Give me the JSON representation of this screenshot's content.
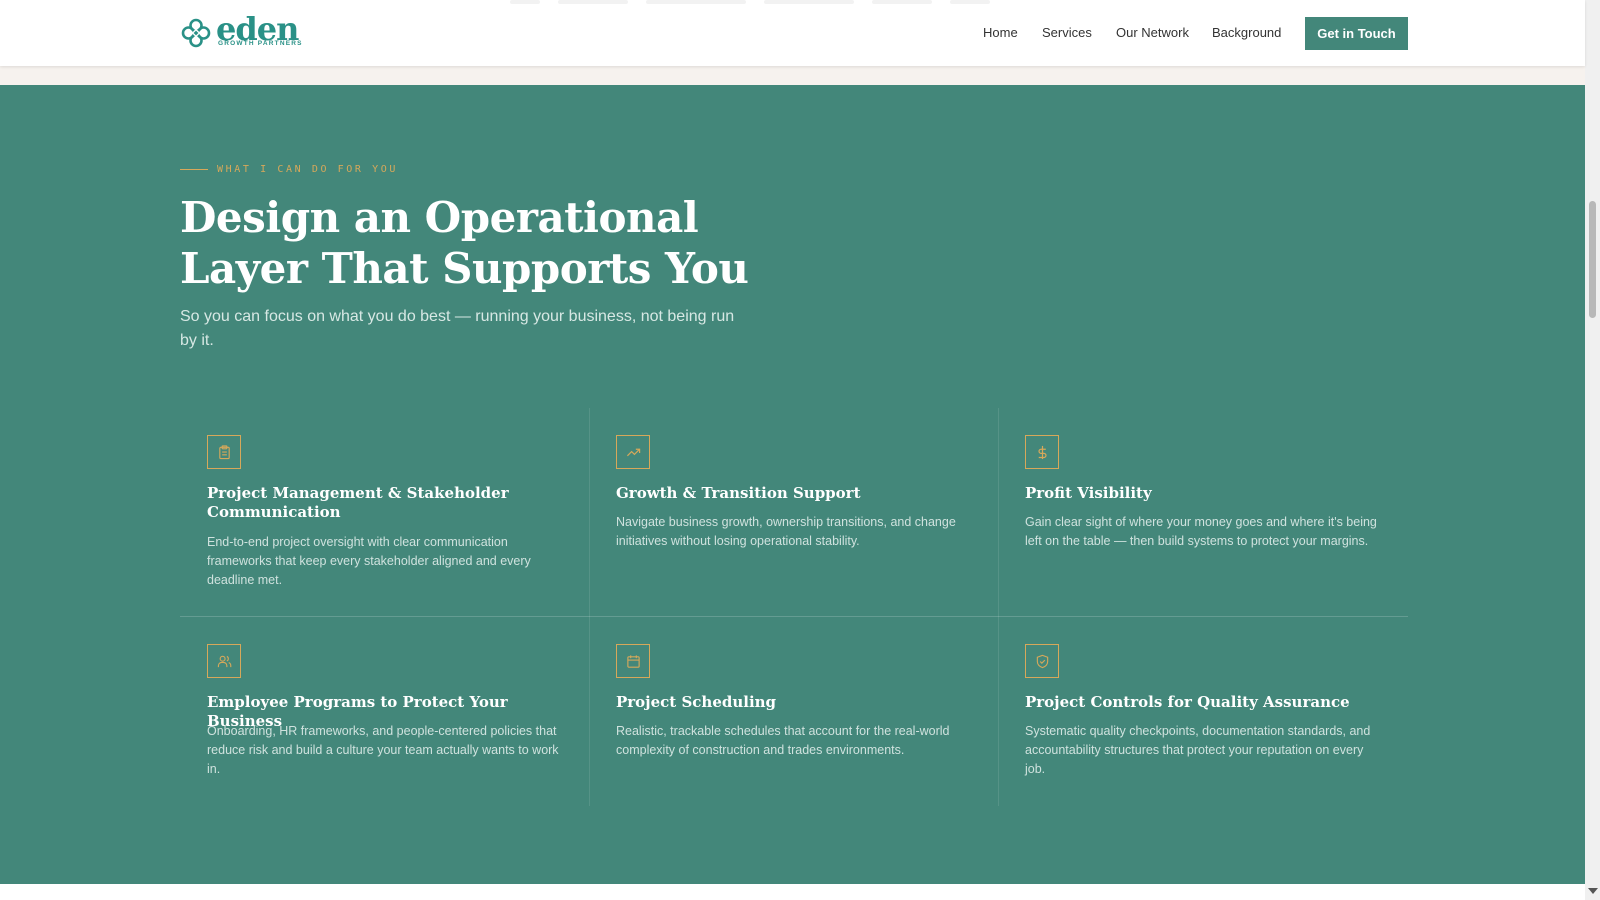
{
  "header": {
    "logo": {
      "word": "eden",
      "sub": "GROWTH PARTNERS"
    },
    "nav": [
      "Home",
      "Services",
      "Our Network",
      "Background"
    ],
    "cta": "Get in Touch"
  },
  "section": {
    "eyebrow": "WHAT I CAN DO FOR YOU",
    "title": "Design an Operational Layer That Supports You",
    "subtitle": "So you can focus on what you do best — running your business, not being run by it.",
    "cards": [
      {
        "icon": "clipboard-icon",
        "title": "Project Management & Stakeholder Communication",
        "desc": "End-to-end project oversight with clear communication frameworks that keep every stakeholder aligned and every deadline met."
      },
      {
        "icon": "trending-up-icon",
        "title": "Growth & Transition Support",
        "desc": "Navigate business growth, ownership transitions, and change initiatives without losing operational stability."
      },
      {
        "icon": "dollar-icon",
        "title": "Profit Visibility",
        "desc": "Gain clear sight of where your money goes and where it's being left on the table — then build systems to protect your margins."
      },
      {
        "icon": "users-icon",
        "title": "Employee Programs to Protect Your Business",
        "desc": "Onboarding, HR frameworks, and people-centered policies that reduce risk and build a culture your team actually wants to work in."
      },
      {
        "icon": "calendar-icon",
        "title": "Project Scheduling",
        "desc": "Realistic, trackable schedules that account for the real-world complexity of construction and trades environments."
      },
      {
        "icon": "shield-check-icon",
        "title": "Project Controls for Quality Assurance",
        "desc": "Systematic quality checkpoints, documentation standards, and accountability structures that protect your reputation on every job."
      }
    ]
  },
  "colors": {
    "brand_teal": "#2a9187",
    "section_bg": "#43877a",
    "accent_gold": "#d6a85a",
    "header_bg": "#ffffff"
  }
}
